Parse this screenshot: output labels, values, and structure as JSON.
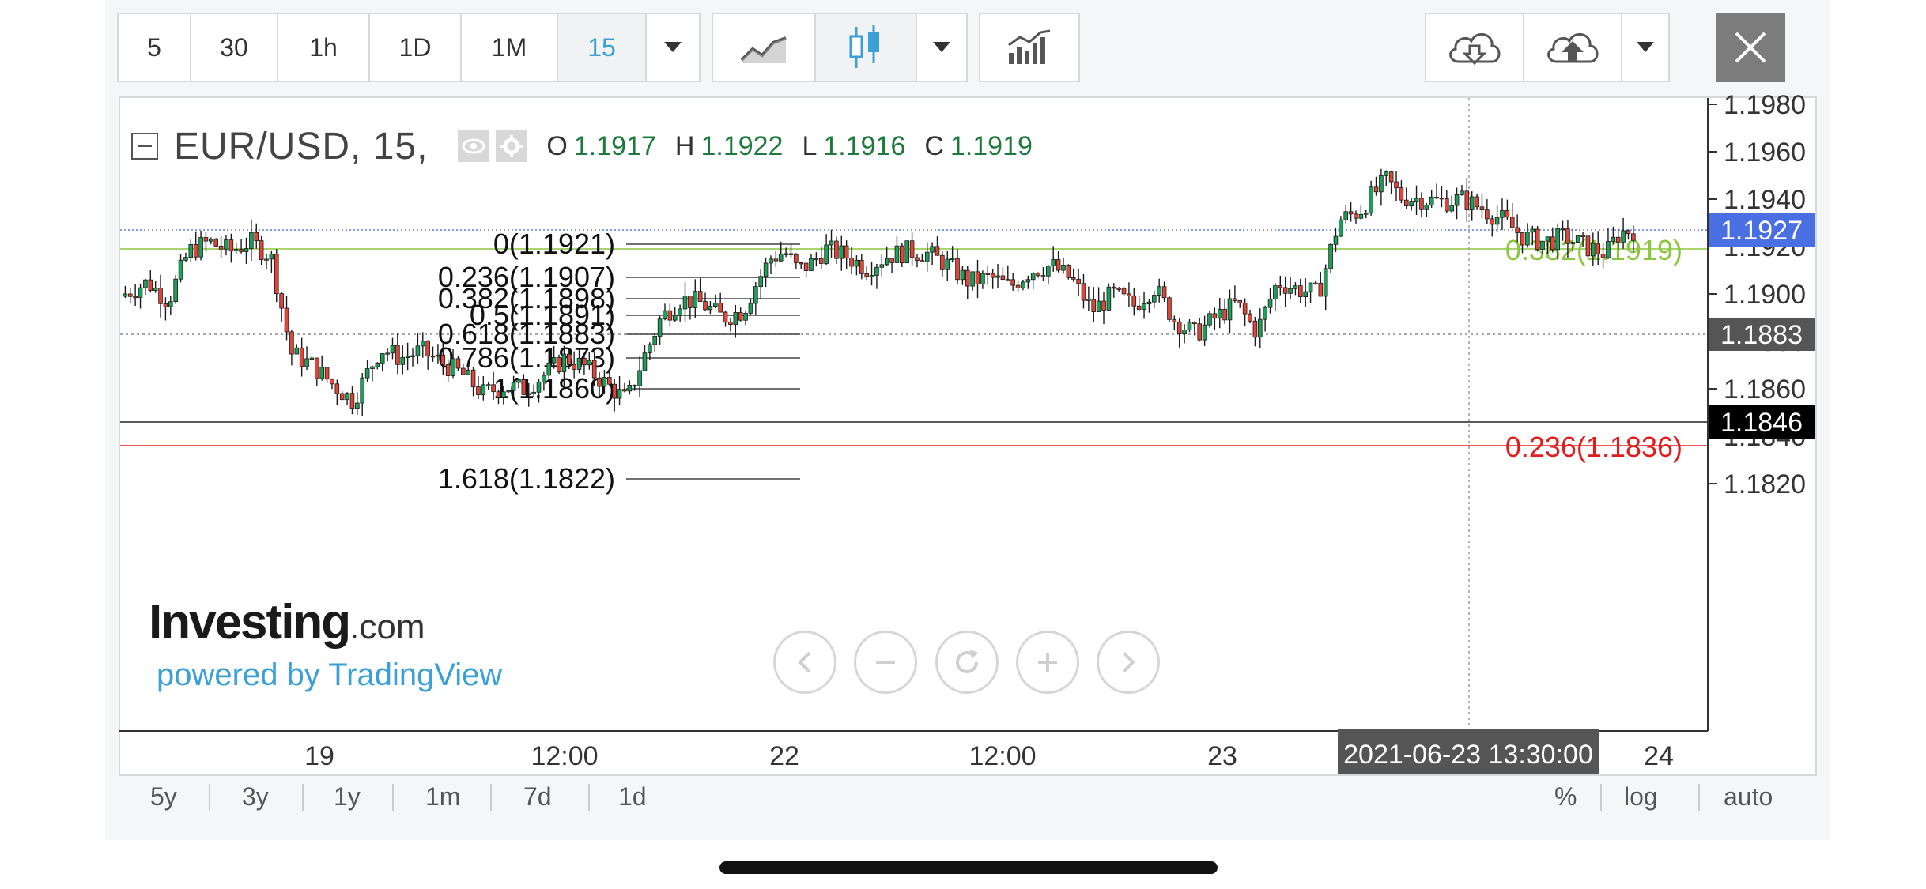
{
  "toolbar": {
    "intervals": [
      "5",
      "30",
      "1h",
      "1D",
      "1M",
      "15"
    ],
    "active_interval": "15",
    "chart_styles": [
      "line-chart-icon",
      "candlestick-icon"
    ],
    "active_style": "candlestick-icon",
    "indicators_icon": "indicators-icon",
    "download_icon": "cloud-download-icon",
    "upload_icon": "cloud-upload-icon",
    "close_icon": "close-icon"
  },
  "legend": {
    "symbol": "EUR/USD, 15,",
    "open_label": "O",
    "open": "1.1917",
    "high_label": "H",
    "high": "1.1922",
    "low_label": "L",
    "low": "1.1916",
    "close_label": "C",
    "close": "1.1919"
  },
  "watermark": {
    "brand": "Investing",
    "brand_suffix": ".com",
    "powered": "powered by TradingView"
  },
  "range_buttons": [
    "5y",
    "3y",
    "1y",
    "1m",
    "7d",
    "1d"
  ],
  "scale_buttons": [
    "%",
    "log",
    "auto"
  ],
  "colors": {
    "up": "#1e9e58",
    "down": "#e0453a",
    "accent": "#3aa0d6",
    "last_price_bg": "#4a6fe3",
    "fib_green": "#8cc63e",
    "fib_red": "#e01e1e"
  },
  "chart_data": {
    "type": "candlestick",
    "symbol": "EUR/USD",
    "interval": "15",
    "ylim": [
      1.181,
      1.1985
    ],
    "y_ticks": [
      "1.1980",
      "1.1960",
      "1.1940",
      "1.1920",
      "1.1900",
      "1.1880",
      "1.1860",
      "1.1840",
      "1.1820"
    ],
    "x_ticks": [
      "19",
      "12:00",
      "22",
      "12:00",
      "23",
      "24"
    ],
    "price_labels": [
      {
        "value": "1.1927",
        "style": "last"
      },
      {
        "value": "1.1883",
        "style": "crosshair"
      },
      {
        "value": "1.1846",
        "style": "line"
      }
    ],
    "crosshair_time": "2021-06-23 13:30:00",
    "fibonacci": [
      {
        "label": "0(1.1921)",
        "price": 1.1921
      },
      {
        "label": "0.236(1.1907)",
        "price": 1.1907
      },
      {
        "label": "0.382(1.1898)",
        "price": 1.1898
      },
      {
        "label": "0.5(1.1891)",
        "price": 1.1891
      },
      {
        "label": "0.618(1.1883)",
        "price": 1.1883
      },
      {
        "label": "0.786(1.1873)",
        "price": 1.1873
      },
      {
        "label": "1(1.1860)",
        "price": 1.186
      },
      {
        "label": "1.618(1.1822)",
        "price": 1.1822
      }
    ],
    "fibonacci_right": [
      {
        "label": "0.382(1.1919)",
        "price": 1.1919,
        "color": "green"
      },
      {
        "label": "0.236(1.1836)",
        "price": 1.1836,
        "color": "red"
      }
    ],
    "horizontal_lines": [
      {
        "price": 1.1927,
        "style": "dotted-blue"
      },
      {
        "price": 1.1919,
        "style": "solid-green"
      },
      {
        "price": 1.1883,
        "style": "dotted-gray"
      },
      {
        "price": 1.1846,
        "style": "solid-black"
      },
      {
        "price": 1.1836,
        "style": "solid-red"
      }
    ],
    "price_path": [
      [
        0,
        1.1899
      ],
      [
        0.02,
        1.1905
      ],
      [
        0.035,
        1.1897
      ],
      [
        0.05,
        1.1918
      ],
      [
        0.065,
        1.1922
      ],
      [
        0.08,
        1.1918
      ],
      [
        0.095,
        1.1922
      ],
      [
        0.11,
        1.1916
      ],
      [
        0.125,
        1.1875
      ],
      [
        0.14,
        1.187
      ],
      [
        0.155,
        1.1862
      ],
      [
        0.17,
        1.1855
      ],
      [
        0.19,
        1.1877
      ],
      [
        0.205,
        1.1873
      ],
      [
        0.22,
        1.1876
      ],
      [
        0.235,
        1.1871
      ],
      [
        0.25,
        1.1866
      ],
      [
        0.265,
        1.1858
      ],
      [
        0.28,
        1.1861
      ],
      [
        0.295,
        1.186
      ],
      [
        0.31,
        1.1866
      ],
      [
        0.325,
        1.1873
      ],
      [
        0.34,
        1.1869
      ],
      [
        0.355,
        1.1862
      ],
      [
        0.37,
        1.1855
      ],
      [
        0.38,
        1.187
      ],
      [
        0.395,
        1.189
      ],
      [
        0.41,
        1.1898
      ],
      [
        0.425,
        1.1896
      ],
      [
        0.44,
        1.189
      ],
      [
        0.455,
        1.1893
      ],
      [
        0.465,
        1.1905
      ],
      [
        0.475,
        1.1915
      ],
      [
        0.485,
        1.1918
      ],
      [
        0.495,
        1.191
      ],
      [
        0.505,
        1.1913
      ],
      [
        0.515,
        1.1919
      ],
      [
        0.53,
        1.1916
      ],
      [
        0.545,
        1.1911
      ],
      [
        0.56,
        1.1916
      ],
      [
        0.575,
        1.1918
      ],
      [
        0.59,
        1.1917
      ],
      [
        0.605,
        1.1912
      ],
      [
        0.62,
        1.1905
      ],
      [
        0.635,
        1.1907
      ],
      [
        0.65,
        1.1903
      ],
      [
        0.665,
        1.191
      ],
      [
        0.68,
        1.1912
      ],
      [
        0.695,
        1.1906
      ],
      [
        0.71,
        1.1893
      ],
      [
        0.725,
        1.19
      ],
      [
        0.74,
        1.1895
      ],
      [
        0.755,
        1.1903
      ],
      [
        0.77,
        1.1889
      ],
      [
        0.785,
        1.1883
      ],
      [
        0.8,
        1.189
      ],
      [
        0.815,
        1.1896
      ],
      [
        0.83,
        1.1884
      ],
      [
        0.845,
        1.1905
      ],
      [
        0.86,
        1.1902
      ],
      [
        0.875,
        1.19
      ],
      [
        0.89,
        1.1931
      ],
      [
        0.905,
        1.1935
      ],
      [
        0.915,
        1.1942
      ],
      [
        0.925,
        1.1948
      ],
      [
        0.935,
        1.1941
      ],
      [
        0.95,
        1.194
      ],
      [
        0.965,
        1.1939
      ],
      [
        0.98,
        1.194
      ],
      [
        0.995,
        1.1936
      ],
      [
        1.01,
        1.1931
      ],
      [
        1.025,
        1.1924
      ],
      [
        1.04,
        1.1922
      ],
      [
        1.055,
        1.1924
      ],
      [
        1.07,
        1.192
      ],
      [
        1.085,
        1.1917
      ],
      [
        1.095,
        1.1926
      ],
      [
        1.105,
        1.1927
      ]
    ]
  }
}
